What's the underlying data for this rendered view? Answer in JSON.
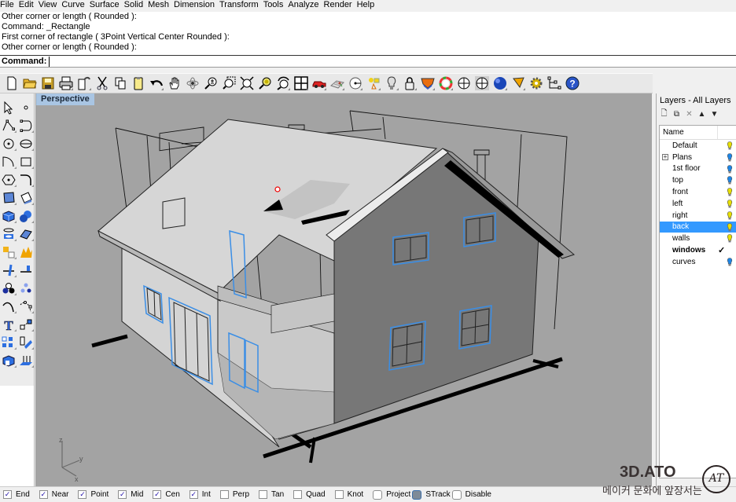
{
  "menu": [
    "File",
    "Edit",
    "View",
    "Curve",
    "Surface",
    "Solid",
    "Mesh",
    "Dimension",
    "Transform",
    "Tools",
    "Analyze",
    "Render",
    "Help"
  ],
  "command_history": [
    "Other corner or length ( Rounded ):",
    "Command: _Rectangle",
    "First corner of rectangle ( 3Point  Vertical  Center  Rounded ):",
    "Other corner or length ( Rounded ):"
  ],
  "command_prompt": {
    "label": "Command:",
    "value": ""
  },
  "toolbar": [
    "new-file",
    "open-folder",
    "save",
    "print",
    "import",
    "cut",
    "copy",
    "paste",
    "undo",
    "pan-hand",
    "rotate-view",
    "zoom",
    "zoom-window",
    "zoom-extents",
    "zoom-selected",
    "undo-view",
    "viewport-layout",
    "car-render",
    "grid-snap",
    "point-target",
    "object-snap",
    "light-bulb",
    "lock",
    "layer-render",
    "color-wheel",
    "wireframe-sphere",
    "ghosted-sphere",
    "shaded-sphere",
    "cursor-tool",
    "gear-settings",
    "tree-structure",
    "help"
  ],
  "palette": [
    "select-arrow",
    "point",
    "polyline",
    "curve-control",
    "circle",
    "ellipse",
    "arc",
    "rectangle",
    "polygon",
    "fillet-curve",
    "surface-from-points",
    "surface-edit",
    "box-solid",
    "sphere-solid",
    "cylinder-solid",
    "mesh-surface",
    "explode",
    "boolean",
    "split",
    "trim",
    "dots-group",
    "scatter",
    "curve-offset",
    "arc-blend",
    "text",
    "move-point",
    "array",
    "transform-scale",
    "solid-edit",
    "extrude"
  ],
  "viewport": {
    "label": "Perspective",
    "axes": {
      "x": "x",
      "y": "y",
      "z": "z"
    }
  },
  "layers": {
    "title": "Layers - All Layers",
    "toolbar": [
      "new-layer",
      "new-sublayer",
      "delete",
      "move-up",
      "move-down"
    ],
    "column_name": "Name",
    "items": [
      {
        "name": "Default",
        "bulb": "#e8e000",
        "state": ""
      },
      {
        "name": "Plans",
        "bulb": "#1c86e8",
        "state": "",
        "expandable": true
      },
      {
        "name": "1st floor",
        "bulb": "#1c86e8",
        "state": ""
      },
      {
        "name": "top",
        "bulb": "#1c86e8",
        "state": ""
      },
      {
        "name": "front",
        "bulb": "#e8e000",
        "state": ""
      },
      {
        "name": "left",
        "bulb": "#e8e000",
        "state": ""
      },
      {
        "name": "right",
        "bulb": "#e8e000",
        "state": ""
      },
      {
        "name": "back",
        "bulb": "#e8e000",
        "state": "selected"
      },
      {
        "name": "walls",
        "bulb": "#e8e000",
        "state": ""
      },
      {
        "name": "windows",
        "bulb": "",
        "state": "current",
        "check": "✓"
      },
      {
        "name": "curves",
        "bulb": "#1c86e8",
        "state": ""
      }
    ]
  },
  "osnap": [
    {
      "label": "End",
      "checked": true
    },
    {
      "label": "Near",
      "checked": true
    },
    {
      "label": "Point",
      "checked": true
    },
    {
      "label": "Mid",
      "checked": true
    },
    {
      "label": "Cen",
      "checked": true
    },
    {
      "label": "Int",
      "checked": true
    },
    {
      "label": "Perp",
      "checked": false
    },
    {
      "label": "Tan",
      "checked": false
    },
    {
      "label": "Quad",
      "checked": false
    },
    {
      "label": "Knot",
      "checked": false
    },
    {
      "label": "Project",
      "checked": false,
      "round": true
    },
    {
      "label": "STrack",
      "checked": true,
      "round": true
    },
    {
      "label": "Disable",
      "checked": false,
      "round": true
    }
  ],
  "watermark": {
    "brand": "3D.ATO",
    "tagline": "메이커 문화에 앞장서는",
    "logo": "AT"
  },
  "colors": {
    "viewport_bg": "#a3a3a3",
    "selection_blue": "#3399ff",
    "window_highlight": "#3a8ee6",
    "tab_bg": "#a9c5e3"
  }
}
